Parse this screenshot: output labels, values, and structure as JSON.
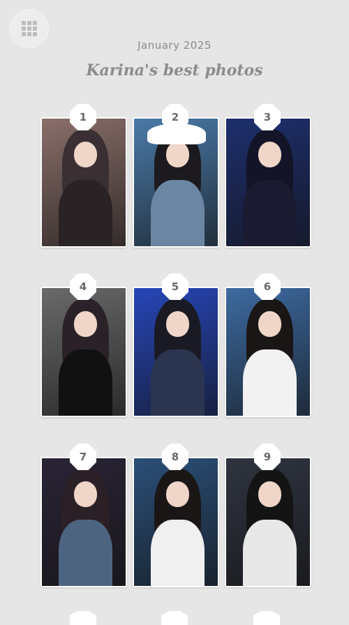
{
  "header": {
    "date": "January 2025",
    "title": "Karina's best photos",
    "menu_icon": "grid-icon"
  },
  "photos": [
    {
      "number": "1",
      "bg": "#8a6f6a",
      "top": "#3a2f33",
      "body": "#2a2326"
    },
    {
      "number": "2",
      "bg": "#4a7aa8",
      "top": "#ffffff",
      "body": "#6b86a3"
    },
    {
      "number": "3",
      "bg": "#1e2f6e",
      "top": "#141428",
      "body": "#1a1a30"
    },
    {
      "number": "4",
      "bg": "#6a6a6a",
      "top": "#2a2228",
      "body": "#111111"
    },
    {
      "number": "5",
      "bg": "#2746b8",
      "top": "#1a1a24",
      "body": "#2b3550"
    },
    {
      "number": "6",
      "bg": "#3d6aa0",
      "top": "#1a1616",
      "body": "#f2f2f2"
    },
    {
      "number": "7",
      "bg": "#2a2436",
      "top": "#2b2026",
      "body": "#4d6480"
    },
    {
      "number": "8",
      "bg": "#2b4f78",
      "top": "#1a1616",
      "body": "#f0f0f0"
    },
    {
      "number": "9",
      "bg": "#2f3440",
      "top": "#141414",
      "body": "#e8e8e8"
    }
  ]
}
